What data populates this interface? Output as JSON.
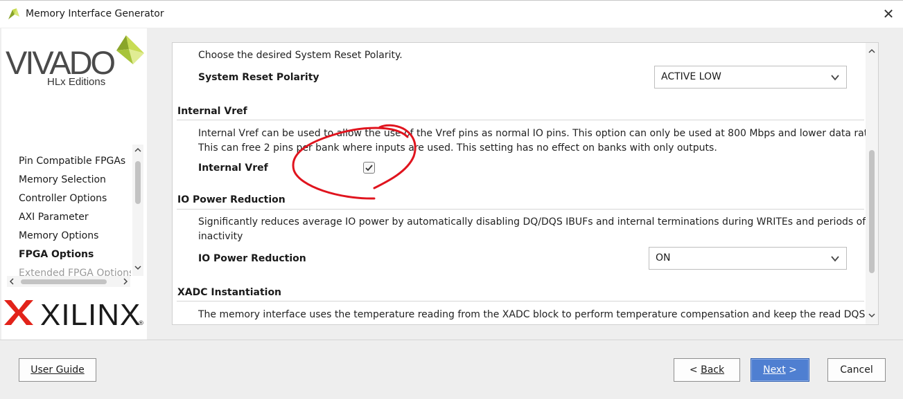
{
  "window": {
    "title": "Memory Interface Generator",
    "close_label": "✕"
  },
  "branding": {
    "vivado": "VIVADO",
    "vivado_sub": "HLx Editions",
    "xilinx": "XILINX",
    "xilinx_reg": "®"
  },
  "sidebar": {
    "items": [
      {
        "label": "Pin Compatible FPGAs",
        "state": "normal"
      },
      {
        "label": "Memory Selection",
        "state": "normal"
      },
      {
        "label": "Controller Options",
        "state": "normal"
      },
      {
        "label": "AXI Parameter",
        "state": "normal"
      },
      {
        "label": "Memory Options",
        "state": "normal"
      },
      {
        "label": "FPGA Options",
        "state": "active"
      },
      {
        "label": "Extended FPGA Options",
        "state": "faded"
      }
    ]
  },
  "content": {
    "reset": {
      "description": "Choose the desired System Reset Polarity.",
      "label": "System Reset Polarity",
      "value": "ACTIVE LOW"
    },
    "vref": {
      "heading": "Internal Vref",
      "description_line1": "Internal Vref can be used to allow the use of the Vref pins as normal IO pins. This option can only be used at 800 Mbps and lower data rates.",
      "description_line2": "This can free 2 pins per bank where inputs are used. This setting has no effect on banks with only outputs.",
      "label": "Internal Vref",
      "checked": true
    },
    "io_power": {
      "heading": "IO Power Reduction",
      "description_line1": "Significantly reduces average IO power by automatically disabling DQ/DQS IBUFs and internal terminations during WRITEs and periods of",
      "description_line2": "inactivity",
      "label": "IO Power Reduction",
      "value": "ON"
    },
    "xadc": {
      "heading": "XADC Instantiation",
      "description_line1": "The memory interface uses the temperature reading from the XADC block to perform temperature compensation and keep the read DQS"
    }
  },
  "buttons": {
    "user_guide": "User Guide",
    "back_prefix": "< ",
    "back": "Back",
    "next": "Next",
    "next_suffix": " >",
    "cancel": "Cancel"
  },
  "colors": {
    "accent": "#4f7fd1",
    "annotation": "#e0141e",
    "vivado_green": "#a7c43a",
    "xilinx_red": "#e2231a"
  }
}
